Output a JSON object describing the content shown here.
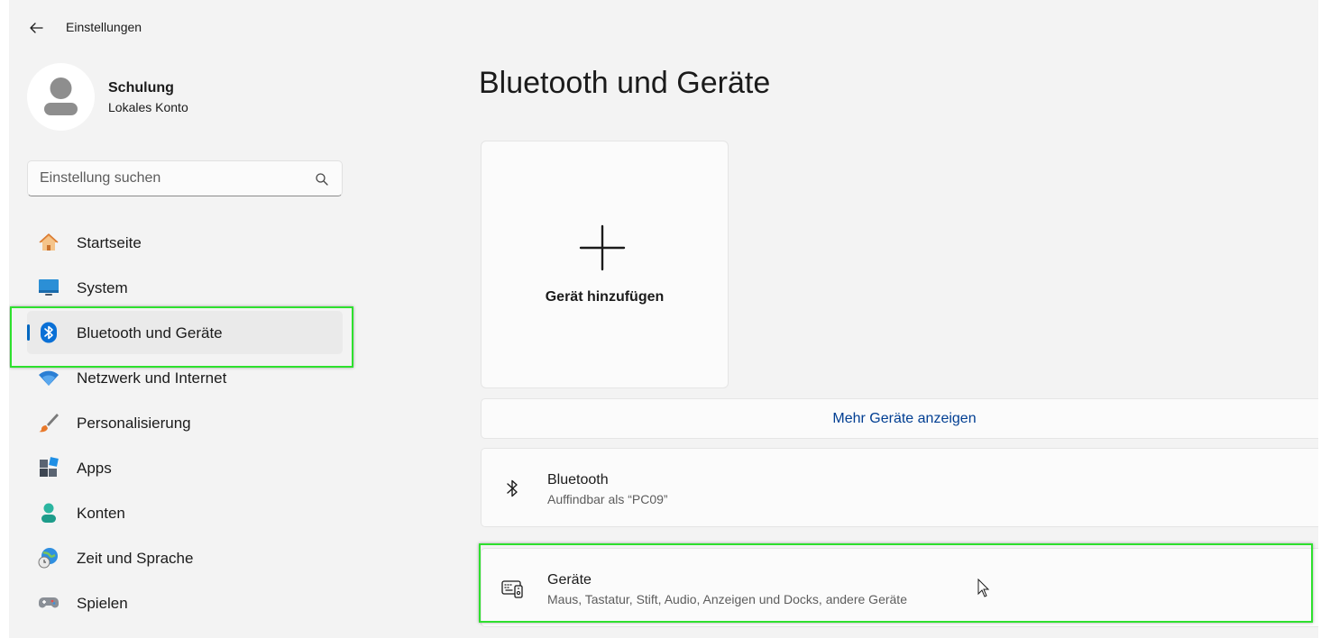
{
  "window": {
    "title": "Einstellungen"
  },
  "profile": {
    "name": "Schulung",
    "account_type": "Lokales Konto"
  },
  "search": {
    "placeholder": "Einstellung suchen"
  },
  "nav": {
    "items": [
      {
        "label": "Startseite",
        "icon": "home-icon"
      },
      {
        "label": "System",
        "icon": "monitor-icon"
      },
      {
        "label": "Bluetooth und Geräte",
        "icon": "bluetooth-icon",
        "active": true
      },
      {
        "label": "Netzwerk und Internet",
        "icon": "wifi-icon"
      },
      {
        "label": "Personalisierung",
        "icon": "brush-icon"
      },
      {
        "label": "Apps",
        "icon": "apps-icon"
      },
      {
        "label": "Konten",
        "icon": "person-icon"
      },
      {
        "label": "Zeit und Sprache",
        "icon": "globe-clock-icon"
      },
      {
        "label": "Spielen",
        "icon": "gamepad-icon"
      }
    ]
  },
  "main": {
    "title": "Bluetooth und Geräte",
    "add_device": {
      "label": "Gerät hinzufügen"
    },
    "more_devices": {
      "label": "Mehr Geräte anzeigen"
    },
    "rows": [
      {
        "title": "Bluetooth",
        "subtitle": "Auffindbar als “PC09”",
        "icon": "bluetooth-icon"
      },
      {
        "title": "Geräte",
        "subtitle": "Maus, Tastatur, Stift, Audio, Anzeigen und Docks, andere Geräte",
        "icon": "devices-icon"
      }
    ]
  },
  "colors": {
    "accent": "#0067c0",
    "link": "#003e92",
    "highlight": "#2ee02e",
    "background": "#f3f3f3",
    "card": "#fbfbfb"
  }
}
